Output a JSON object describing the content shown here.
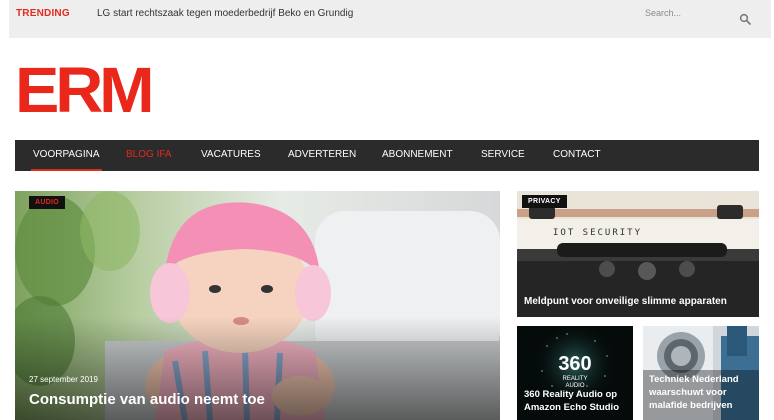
{
  "topbar": {
    "trending_label": "TRENDING",
    "trending_text": "LG start rechtszaak tegen moederbedrijf Beko en Grundig",
    "search_placeholder": "Search...",
    "search_icon": "search-icon"
  },
  "logo": {
    "text": "ERM"
  },
  "nav": {
    "items": [
      {
        "label": "VOORPAGINA"
      },
      {
        "label": "BLOG IFA"
      },
      {
        "label": "VACATURES"
      },
      {
        "label": "ADVERTEREN"
      },
      {
        "label": "ABONNEMENT"
      },
      {
        "label": "SERVICE"
      },
      {
        "label": "CONTACT"
      }
    ]
  },
  "feature": {
    "category": "AUDIO",
    "date": "27 september 2019",
    "title": "Consumptie van audio neemt toe"
  },
  "side": {
    "privacy_card": {
      "category": "PRIVACY",
      "image_caption": "IOT SECURITY",
      "title": "Meldpunt voor onveilige slimme apparaten"
    },
    "audio_card": {
      "logo_number": "360",
      "logo_line1": "REALITY",
      "logo_line2": "AUDIO",
      "title_line1": "360 Reality Audio op",
      "title_line2": "Amazon Echo Studio"
    },
    "tech_card": {
      "title_line1": "Techniek Nederland",
      "title_line2": "waarschuwt voor",
      "title_line3": "malafide bedrijven"
    }
  },
  "colors": {
    "brand_red": "#e9271b",
    "nav_bg": "#2b2b2b",
    "topbar_bg": "#eeeeee"
  }
}
